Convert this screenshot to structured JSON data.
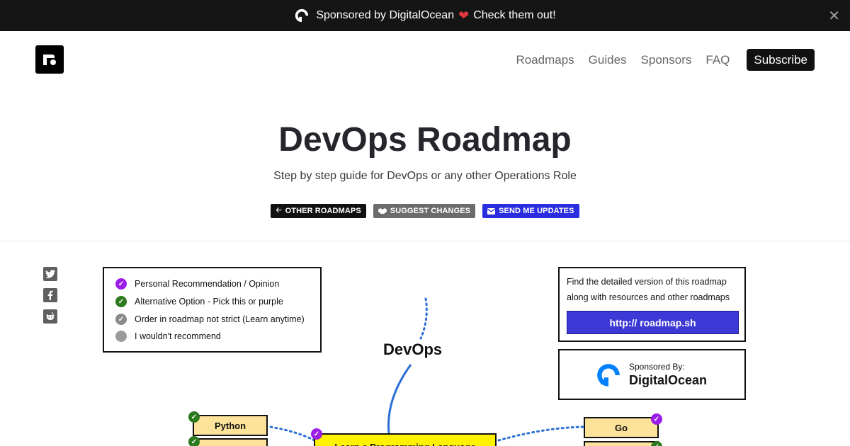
{
  "banner": {
    "text_before": "Sponsored by DigitalOcean",
    "heart": "❤",
    "text_after": "Check them out!",
    "close": "✕"
  },
  "nav": {
    "links": [
      "Roadmaps",
      "Guides",
      "Sponsors",
      "FAQ"
    ],
    "subscribe": "Subscribe"
  },
  "hero": {
    "title": "DevOps Roadmap",
    "subtitle": "Step by step guide for DevOps or any other Operations Role",
    "buttons": {
      "other": "OTHER ROADMAPS",
      "suggest": "SUGGEST CHANGES",
      "updates": "SEND ME UPDATES"
    }
  },
  "share": {
    "icons": [
      "twitter-icon",
      "facebook-icon",
      "reddit-icon"
    ]
  },
  "legend": {
    "items": [
      {
        "label": "Personal Recommendation / Opinion",
        "color": "#9b1de8"
      },
      {
        "label": "Alternative Option - Pick this or purple",
        "color": "#2b7a1f"
      },
      {
        "label": "Order in roadmap not strict (Learn anytime)",
        "color": "#8a8a8a"
      },
      {
        "label": "I wouldn't recommend",
        "color": "#9a9a9a"
      }
    ]
  },
  "info": {
    "line1": "Find the detailed version of this roadmap",
    "line2": "along with resources and other roadmaps",
    "url": "http:// roadmap.sh"
  },
  "sponsor": {
    "label": "Sponsored By:",
    "name": "DigitalOcean"
  },
  "roadmap": {
    "center": "DevOps",
    "nodes": {
      "python": "Python",
      "go": "Go",
      "language": "Learn a Programming Language"
    }
  },
  "colors": {
    "accent_blue": "#2b2ee0",
    "purple": "#9b1de8",
    "green": "#2b7a1f",
    "node_fill": "#fde39a",
    "node_yellow": "#fff200",
    "link_blue": "#2a6fd6"
  }
}
